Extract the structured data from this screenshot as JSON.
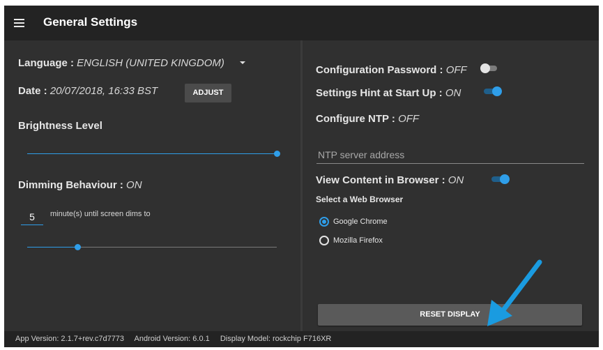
{
  "header": {
    "title": "General Settings",
    "menu_icon": "hamburger-menu-icon"
  },
  "left": {
    "language_label": "Language : ",
    "language_value": "ENGLISH (UNITED KINGDOM)",
    "date_label": "Date : ",
    "date_value": "20/07/2018, 16:33 BST",
    "adjust_label": "ADJUST",
    "brightness_label": "Brightness Level",
    "brightness_level": 1.0,
    "dimming_label": "Dimming Behaviour : ",
    "dimming_value": "ON",
    "dim_minutes": "5",
    "dim_minutes_label": "minute(s) until screen dims to",
    "dim_level": 0.2
  },
  "right": {
    "config_password_label": "Configuration Password : ",
    "config_password_value": "OFF",
    "config_password_on": false,
    "settings_hint_label": "Settings Hint at Start Up : ",
    "settings_hint_value": "ON",
    "settings_hint_on": true,
    "configure_ntp_label": "Configure NTP : ",
    "configure_ntp_value": "OFF",
    "ntp_placeholder": "NTP server address",
    "ntp_value": "",
    "view_content_label": "View Content in Browser : ",
    "view_content_value": "ON",
    "view_content_on": true,
    "select_browser_label": "Select a Web Browser",
    "browser_options": [
      "Google Chrome",
      "Mozilla Firefox"
    ],
    "selected_browser": "Google Chrome",
    "reset_label": "RESET DISPLAY"
  },
  "footer": {
    "app_version": "App Version: 2.1.7+rev.c7d7773",
    "android_version": "Android Version: 6.0.1",
    "display_model": "Display Model: rockchip F716XR"
  },
  "colors": {
    "accent": "#2f9ee9",
    "annotation_arrow": "#1a9be0",
    "background": "#2f2f2f",
    "topbar": "#232323"
  }
}
